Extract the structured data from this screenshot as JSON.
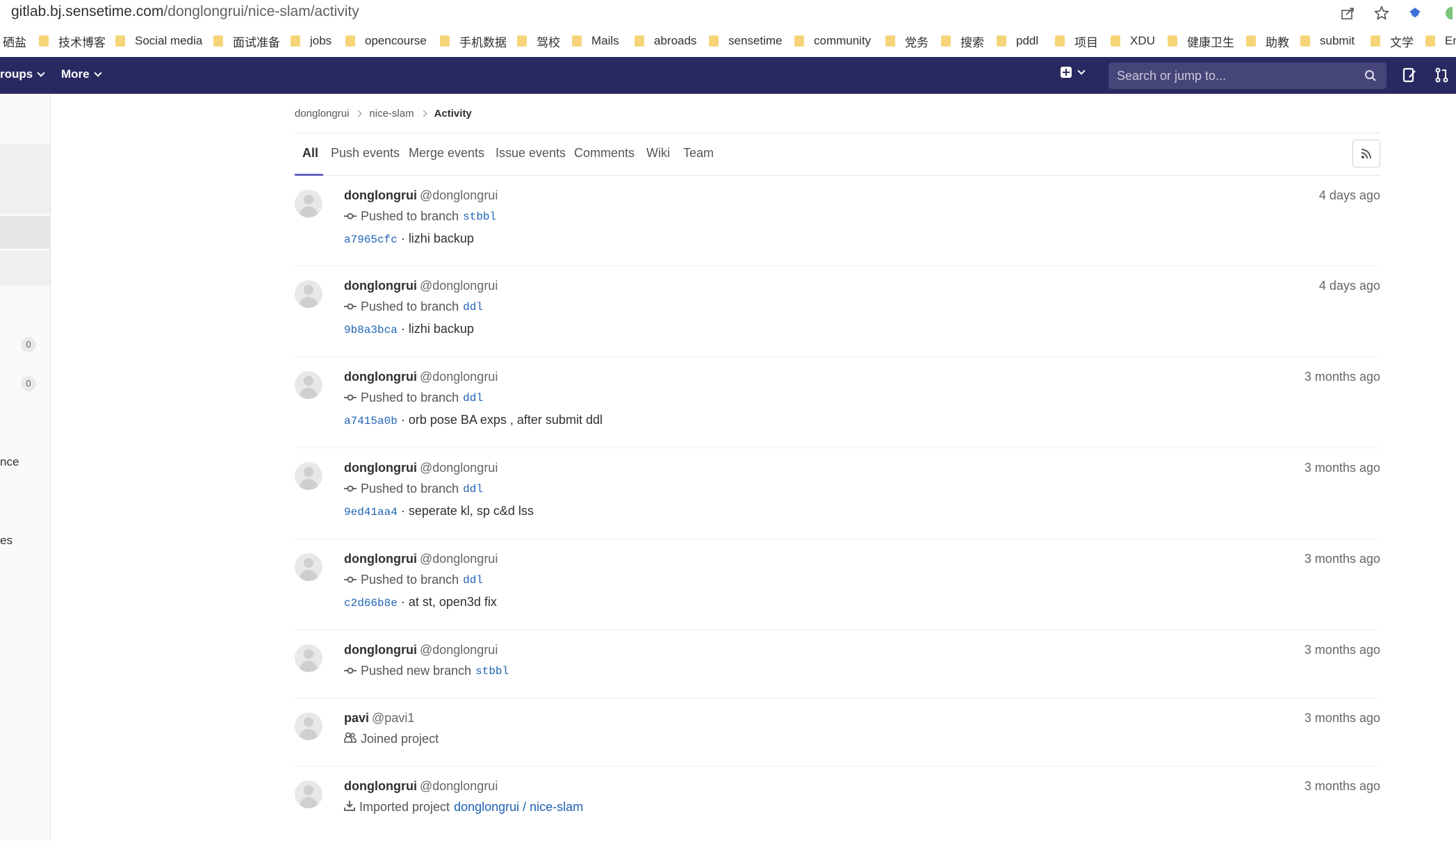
{
  "browser": {
    "url_host": "gitlab.bj.sensetime.com",
    "url_path": "/donglongrui/nice-slam/activity",
    "icons": [
      "share-icon",
      "star-icon",
      "extension-icon",
      "profile-icon"
    ]
  },
  "bookmarks": [
    {
      "label": "硒盐",
      "folder": false
    },
    {
      "label": "技术博客",
      "folder": true
    },
    {
      "label": "Social media",
      "folder": true
    },
    {
      "label": "面试准备",
      "folder": true
    },
    {
      "label": "jobs",
      "folder": true
    },
    {
      "label": "opencourse",
      "folder": true
    },
    {
      "label": "手机数据",
      "folder": true
    },
    {
      "label": "驾校",
      "folder": true
    },
    {
      "label": "Mails",
      "folder": true
    },
    {
      "label": "abroads",
      "folder": true
    },
    {
      "label": "sensetime",
      "folder": true
    },
    {
      "label": "community",
      "folder": true
    },
    {
      "label": "党务",
      "folder": true
    },
    {
      "label": "搜索",
      "folder": true
    },
    {
      "label": "pddl",
      "folder": true
    },
    {
      "label": "项目",
      "folder": true
    },
    {
      "label": "XDU",
      "folder": true
    },
    {
      "label": "健康卫生",
      "folder": true
    },
    {
      "label": "助教",
      "folder": true
    },
    {
      "label": "submit",
      "folder": true
    },
    {
      "label": "文学",
      "folder": true
    },
    {
      "label": "En",
      "folder": true
    }
  ],
  "topnav": {
    "groups_label": "roups",
    "more_label": "More",
    "search_placeholder": "Search or jump to...",
    "colors": {
      "bg": "#292961",
      "search_bg": "#45457a"
    }
  },
  "sidebar": {
    "badges": [
      "0",
      "0"
    ],
    "labels": [
      "nce",
      "es"
    ]
  },
  "breadcrumb": [
    "donglongrui",
    "nice-slam",
    "Activity"
  ],
  "tabs": [
    "All",
    "Push events",
    "Merge events",
    "Issue events",
    "Comments",
    "Wiki",
    "Team"
  ],
  "active_tab": "All",
  "events": [
    {
      "name": "donglongrui",
      "handle": "@donglongrui",
      "time": "4 days ago",
      "action": "Pushed to branch",
      "ref": "stbbl",
      "icon": "commit-icon",
      "commit": "a7965cfc",
      "message": "lizhi backup"
    },
    {
      "name": "donglongrui",
      "handle": "@donglongrui",
      "time": "4 days ago",
      "action": "Pushed to branch",
      "ref": "ddl",
      "icon": "commit-icon",
      "commit": "9b8a3bca",
      "message": "lizhi backup"
    },
    {
      "name": "donglongrui",
      "handle": "@donglongrui",
      "time": "3 months ago",
      "action": "Pushed to branch",
      "ref": "ddl",
      "icon": "commit-icon",
      "commit": "a7415a0b",
      "message": "orb pose BA exps , after submit ddl"
    },
    {
      "name": "donglongrui",
      "handle": "@donglongrui",
      "time": "3 months ago",
      "action": "Pushed to branch",
      "ref": "ddl",
      "icon": "commit-icon",
      "commit": "9ed41aa4",
      "message": "seperate kl, sp c&d lss"
    },
    {
      "name": "donglongrui",
      "handle": "@donglongrui",
      "time": "3 months ago",
      "action": "Pushed to branch",
      "ref": "ddl",
      "icon": "commit-icon",
      "commit": "c2d66b8e",
      "message": "at st, open3d fix"
    },
    {
      "name": "donglongrui",
      "handle": "@donglongrui",
      "time": "3 months ago",
      "action": "Pushed new branch",
      "ref": "stbbl",
      "icon": "commit-icon"
    },
    {
      "name": "pavi",
      "handle": "@pavi1",
      "time": "3 months ago",
      "action": "Joined project",
      "icon": "users-icon"
    },
    {
      "name": "donglongrui",
      "handle": "@donglongrui",
      "time": "3 months ago",
      "action": "Imported project",
      "project_link": "donglongrui / nice-slam",
      "icon": "import-icon"
    }
  ]
}
